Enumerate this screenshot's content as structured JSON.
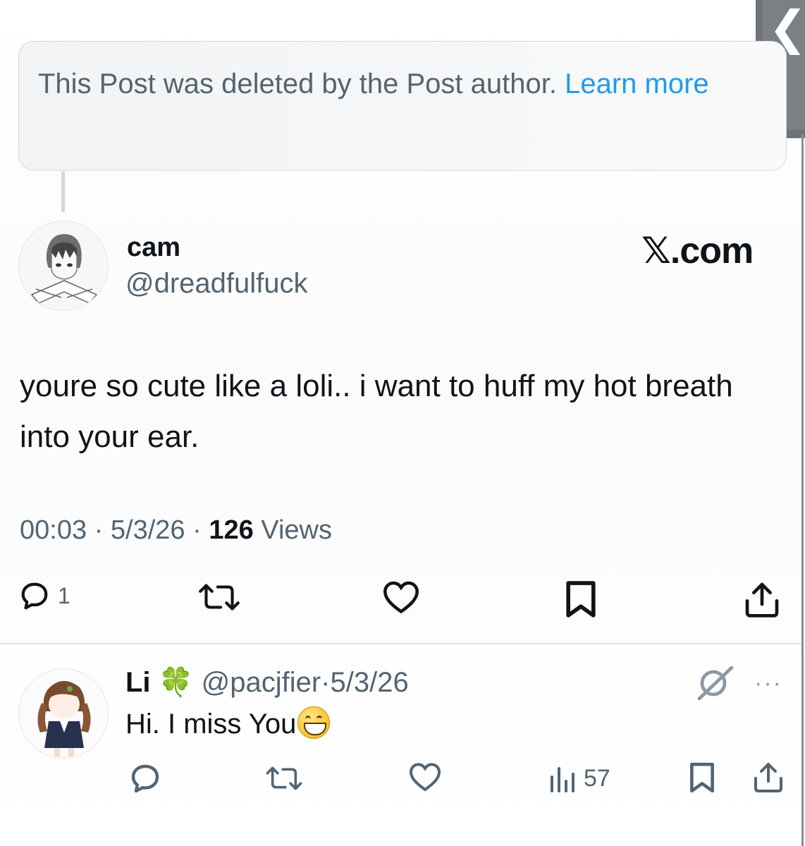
{
  "notice": {
    "text": "This Post was deleted by the Post author. ",
    "link": "Learn more"
  },
  "side_handle": {
    "icon": "chevron-left-icon"
  },
  "post": {
    "display_name": "cam",
    "handle": "@dreadfulfuck",
    "brand": "𝕏.com",
    "text": "youre so cute like a loli.. i want to huff my hot breath into your ear.",
    "time": "00:03",
    "date": "5/3/26",
    "views_count": "126",
    "views_label": "Views",
    "actions": {
      "reply_count": "1",
      "icons": [
        "reply-icon",
        "repost-icon",
        "like-icon",
        "bookmark-icon",
        "share-icon"
      ]
    }
  },
  "reply": {
    "display_name": "Li",
    "name_emoji": "🍀",
    "handle": "@pacjfier",
    "date": "5/3/26",
    "separator": "·",
    "text": "Hi. I miss You",
    "text_emoji": "grinning-face-emoji",
    "views_count": "57",
    "more": "···",
    "icons": [
      "grok-icon",
      "more-icon",
      "reply-icon",
      "repost-icon",
      "like-icon",
      "views-icon",
      "bookmark-icon",
      "share-icon"
    ]
  },
  "colors": {
    "link": "#1d9bf0",
    "muted": "#536471",
    "text": "#0f1419",
    "border": "#cfd9de"
  }
}
